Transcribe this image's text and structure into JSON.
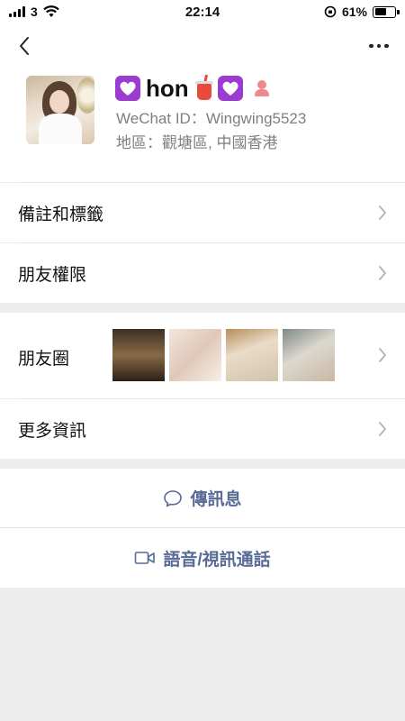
{
  "status_bar": {
    "carrier": "3",
    "time": "22:14",
    "battery_percent": "61%",
    "battery_level": 0.61
  },
  "nav": {
    "back_icon": "chevron-left-icon",
    "more_icon": "more-dots-icon"
  },
  "profile": {
    "name": "hon",
    "name_prefix_emoji": "purple-heart-emoji",
    "name_suffix_emojis": [
      "bubble-tea-emoji",
      "purple-heart-emoji"
    ],
    "gender_icon": "female-icon",
    "wechat_id": "WeChat ID：Wingwing5523",
    "region": "地區：觀塘區, 中國香港"
  },
  "settings": {
    "remarks_tags": "備註和標籤",
    "friend_permissions": "朋友權限"
  },
  "info": {
    "moments": "朋友圈",
    "more_info": "更多資訊"
  },
  "actions": {
    "message": "傳訊息",
    "call": "語音/視訊通話"
  },
  "colors": {
    "background": "#ededed",
    "link": "#576b95",
    "secondary_text": "#7f7f7f"
  }
}
